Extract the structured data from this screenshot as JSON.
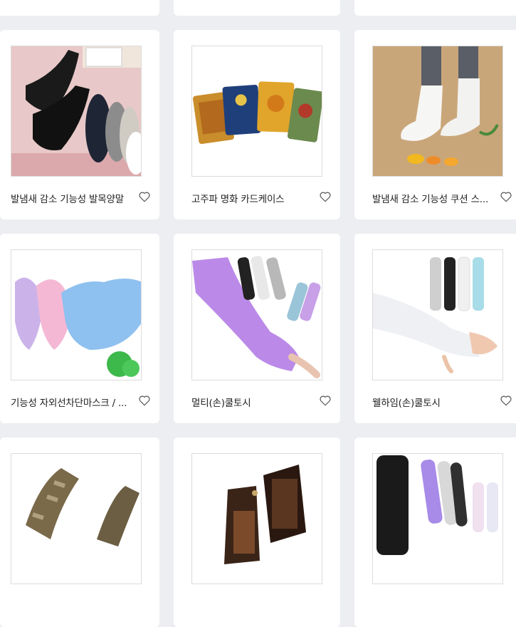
{
  "products": [
    {
      "title": "발냄새 감소 기능성 발목양말",
      "image": "black-navy-grey-no-show-socks"
    },
    {
      "title": "고주파 명화 카드케이스",
      "image": "famous-painting-card-cases"
    },
    {
      "title": "발냄새 감소 기능성 쿠션 스...",
      "image": "white-ankle-socks"
    },
    {
      "title": "기능성 자외선차단마스크 / ...",
      "image": "pastel-uv-face-masks"
    },
    {
      "title": "멀티(손)쿨토시",
      "image": "purple-cooling-arm-sleeves"
    },
    {
      "title": "웰하임(손)쿨토시",
      "image": "white-cooling-arm-sleeves"
    },
    {
      "title": "",
      "image": "camo-neck-scarf"
    },
    {
      "title": "",
      "image": "brown-leather-wallets"
    },
    {
      "title": "",
      "image": "black-purple-arm-sleeves"
    }
  ],
  "icons": {
    "favorite": "heart-outline-icon"
  },
  "colors": {
    "background": "#eceef1",
    "card": "#ffffff",
    "text": "#222222"
  }
}
